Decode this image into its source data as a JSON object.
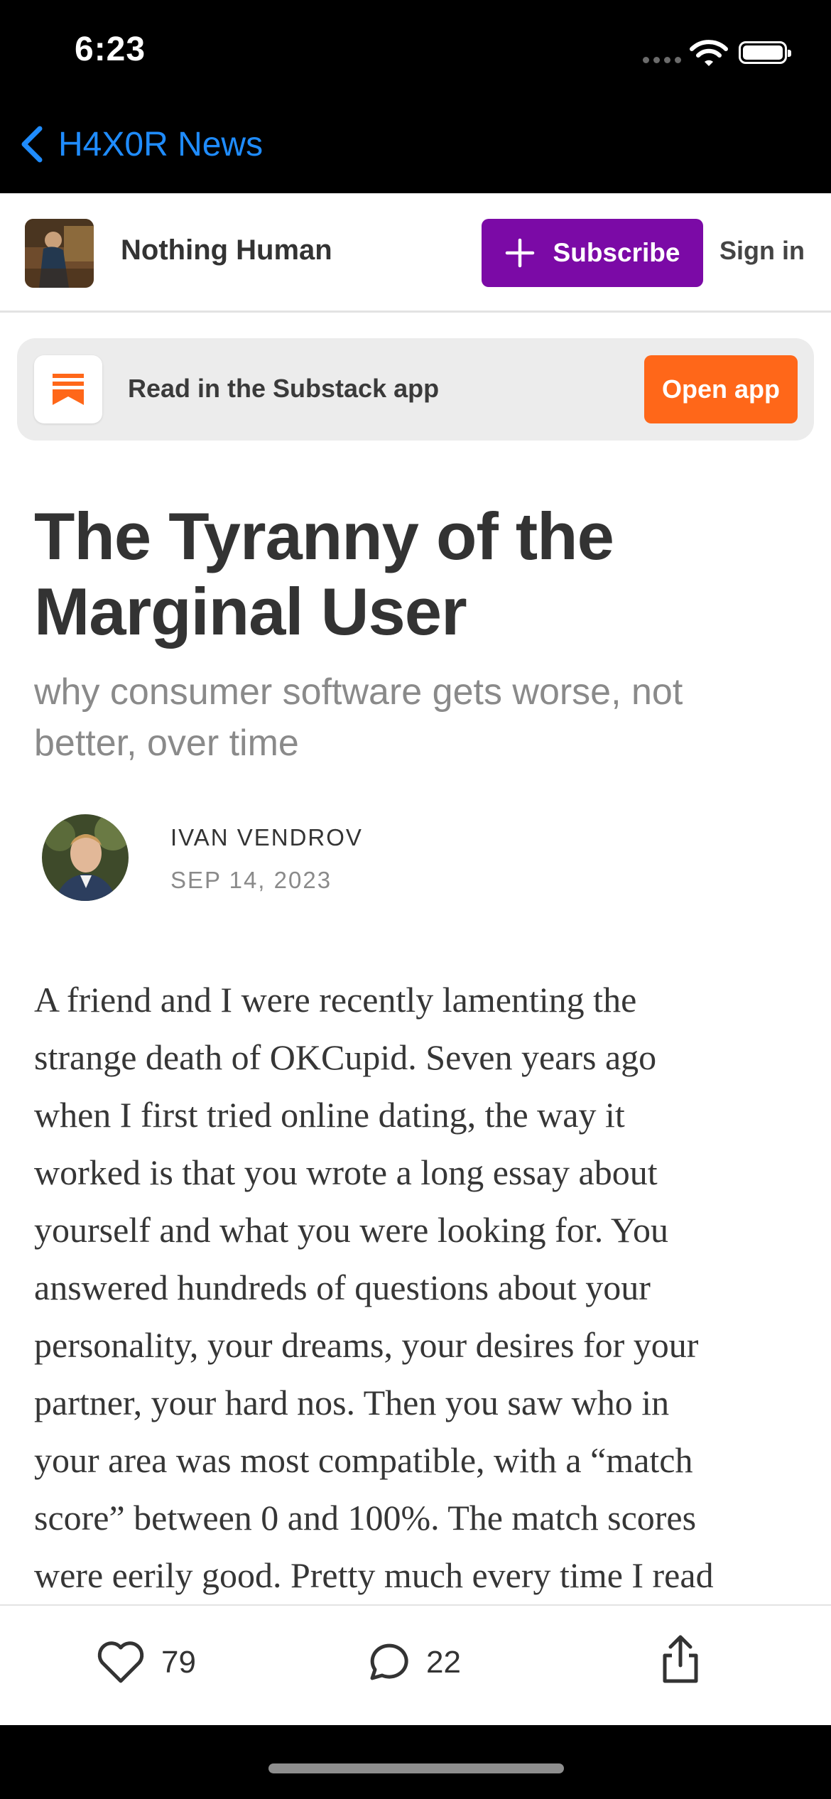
{
  "status_bar": {
    "time": "6:23"
  },
  "nav": {
    "back_label": "H4X0R News"
  },
  "publication": {
    "name": "Nothing Human",
    "subscribe_label": "Subscribe",
    "signin_label": "Sign in"
  },
  "app_banner": {
    "text": "Read in the Substack app",
    "button_label": "Open app",
    "accent_color": "#ff6719"
  },
  "post": {
    "title_lines": [
      "The Tyranny of the",
      "Marginal User"
    ],
    "subtitle_lines": [
      "why consumer software gets worse, not",
      "better, over time"
    ],
    "author": "IVAN VENDROV",
    "date": "SEP 14, 2023",
    "body_lines": [
      "A friend and I were recently lamenting the",
      "strange death of OKCupid. Seven years ago",
      "when I first tried online dating, the way it",
      "worked is that you wrote a long essay about",
      "yourself and what you were looking for. You",
      "answered hundreds of questions about your",
      "personality, your dreams, your desires for your",
      "partner, your hard nos. Then you saw who in",
      "your area was most compatible, with a “match",
      "score” between 0 and 100%. The match scores",
      "were eerily good. Pretty much every time I read"
    ]
  },
  "actions": {
    "like_count": "79",
    "comment_count": "22"
  },
  "colors": {
    "subscribe": "#7b0aa6",
    "nav_link": "#1f8cff"
  },
  "icons": [
    "chevron-left-icon",
    "wifi-icon",
    "battery-icon",
    "plus-icon",
    "substack-bookmark-icon",
    "heart-icon",
    "comment-icon",
    "share-icon"
  ]
}
